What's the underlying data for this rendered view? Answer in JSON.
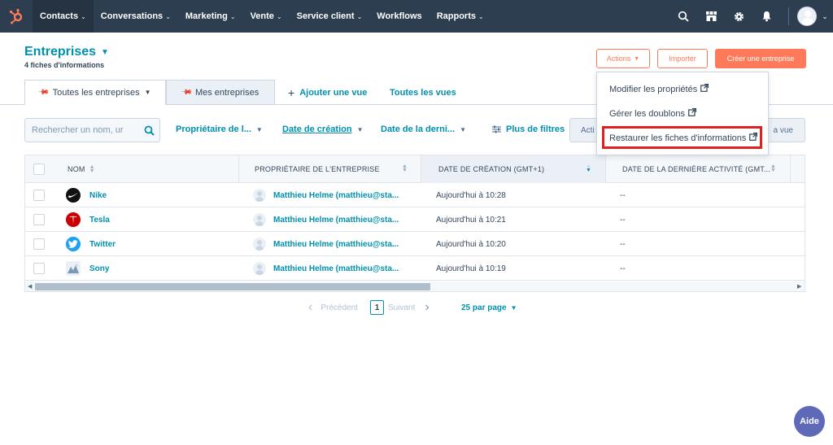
{
  "nav": {
    "items": [
      {
        "label": "Contacts",
        "dropdown": true,
        "active": true
      },
      {
        "label": "Conversations",
        "dropdown": true
      },
      {
        "label": "Marketing",
        "dropdown": true
      },
      {
        "label": "Vente",
        "dropdown": true
      },
      {
        "label": "Service client",
        "dropdown": true
      },
      {
        "label": "Workflows",
        "dropdown": false
      },
      {
        "label": "Rapports",
        "dropdown": true
      }
    ],
    "chevron": "⌄"
  },
  "header": {
    "title": "Entreprises",
    "subtitle": "4 fiches d'informations",
    "actions_label": "Actions",
    "import_label": "Importer",
    "create_label": "Créer une entreprise"
  },
  "tabs": {
    "all": "Toutes les entreprises",
    "mine": "Mes entreprises",
    "add": "Ajouter une vue",
    "views": "Toutes les vues"
  },
  "filters": {
    "search_placeholder": "Rechercher un nom, ur",
    "owner": "Propriétaire de l...",
    "created": "Date de création",
    "last_activity": "Date de la derni...",
    "more": "Plus de filtres",
    "actions_partial": "Acti",
    "view_partial": "a vue"
  },
  "table": {
    "headers": {
      "name": "NOM",
      "owner": "PROPRIÉTAIRE DE L'ENTREPRISE",
      "created": "DATE DE CRÉATION (GMT+1)",
      "activity": "DATE DE LA DERNIÈRE ACTIVITÉ (GMT..."
    },
    "rows": [
      {
        "name": "Nike",
        "owner": "Matthieu Helme (matthieu@sta...",
        "created": "Aujourd'hui à 10:28",
        "activity": "--",
        "logo": "nike-logo"
      },
      {
        "name": "Tesla",
        "owner": "Matthieu Helme (matthieu@sta...",
        "created": "Aujourd'hui à 10:21",
        "activity": "--",
        "logo": "tesla-logo"
      },
      {
        "name": "Twitter",
        "owner": "Matthieu Helme (matthieu@sta...",
        "created": "Aujourd'hui à 10:20",
        "activity": "--",
        "logo": "twitter-logo"
      },
      {
        "name": "Sony",
        "owner": "Matthieu Helme (matthieu@sta...",
        "created": "Aujourd'hui à 10:19",
        "activity": "--",
        "logo": "sony-logo"
      }
    ]
  },
  "pagination": {
    "prev": "Précédent",
    "current": "1",
    "next": "Suivant",
    "per_page": "25 par page"
  },
  "menu": {
    "items": [
      "Modifier les propriétés",
      "Gérer les doublons",
      "Restaurer les fiches d'informations"
    ]
  },
  "help": "Aide",
  "colors": {
    "nav_bg": "#2d3e50",
    "accent": "#ff7a59",
    "link": "#0091ae",
    "highlight": "#e0201e",
    "help_bg": "#5e6ab8"
  }
}
